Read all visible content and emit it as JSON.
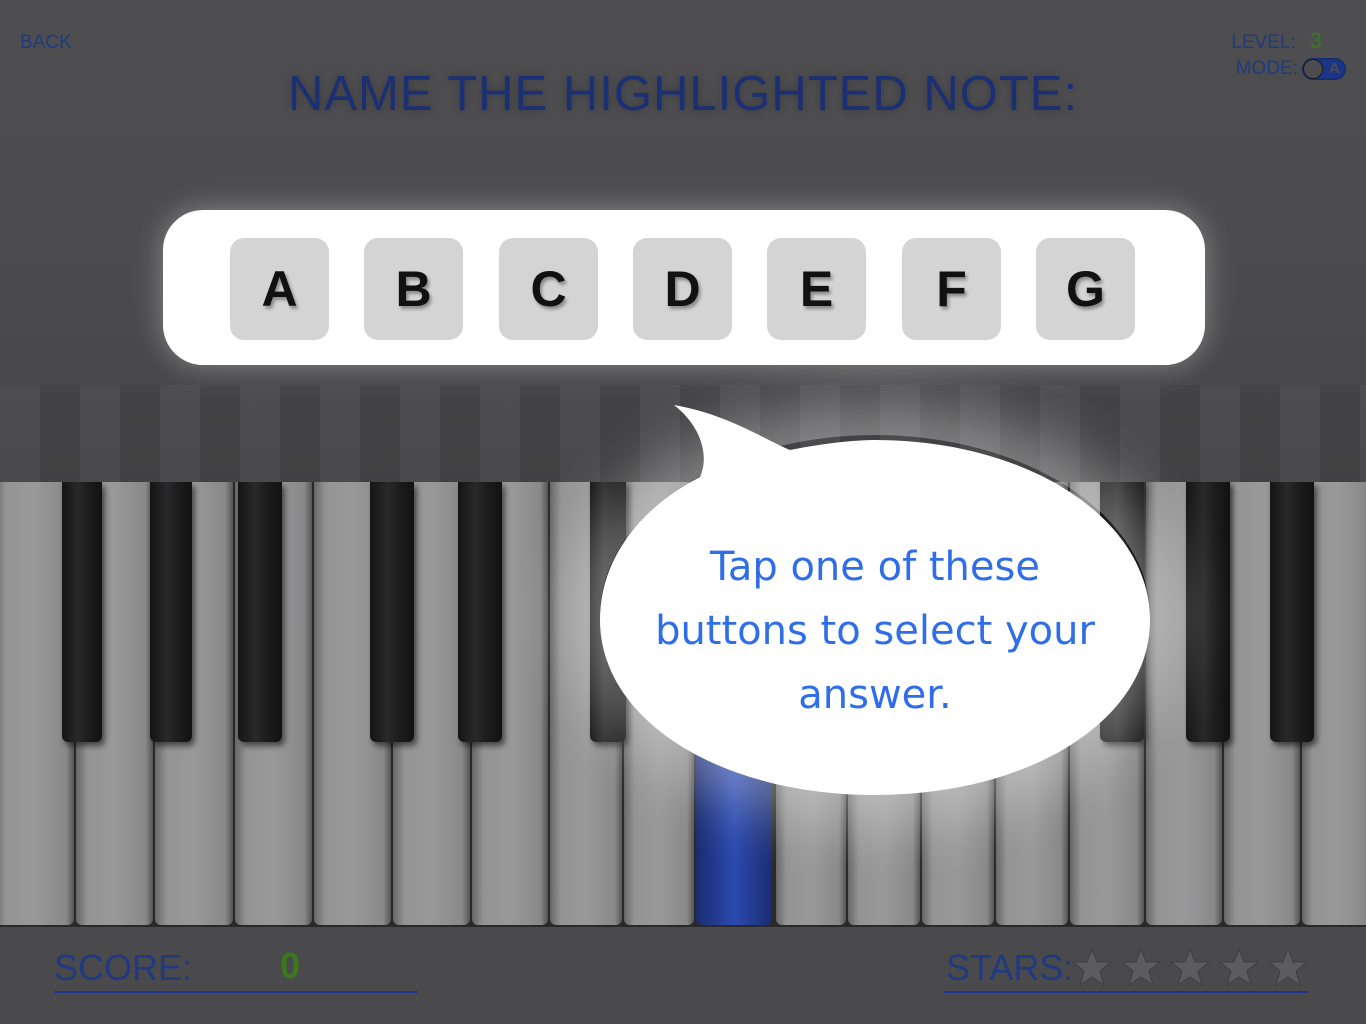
{
  "header": {
    "back_label": "BACK",
    "title": "NAME THE HIGHLIGHTED NOTE:",
    "level_label": "LEVEL:",
    "level_value": "3",
    "mode_label": "MODE:",
    "mode_value": "A"
  },
  "answers": {
    "buttons": [
      "A",
      "B",
      "C",
      "D",
      "E",
      "F",
      "G"
    ]
  },
  "tooltip": {
    "line1": "Tap one of these",
    "line2": "buttons to select your",
    "line3": "answer."
  },
  "footer": {
    "score_label": "SCORE:",
    "score_value": "0",
    "stars_label": "STARS:",
    "stars_earned": 0,
    "stars_total": 5
  },
  "colors": {
    "title_blue": "#1b2f74",
    "value_green": "#3a7a1c",
    "bubble_text": "#2f6ee8",
    "highlight_key": "#2b4ab0"
  },
  "icons": {
    "star": "star-icon",
    "speech_bubble": "speech-bubble"
  }
}
